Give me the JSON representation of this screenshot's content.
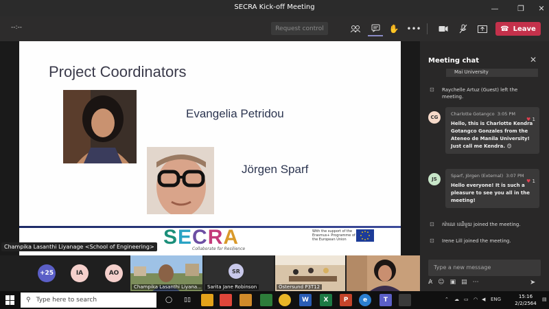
{
  "window": {
    "title": "SECRA Kick-off Meeting"
  },
  "toolbar": {
    "timer": "--:--",
    "request_control": "Request control",
    "leave": "Leave"
  },
  "slide": {
    "title": "Project Coordinators",
    "person1": "Evangelia Petridou",
    "person2": "Jörgen Sparf",
    "logo_letters": [
      "S",
      "E",
      "C",
      "R",
      "A"
    ],
    "tagline": "Collaborate for Resilience",
    "erasmus": "With the support of the Erasmus+ Programme of the European Union"
  },
  "presenter_label": "Champika Lasanthi Liyanage <School of Engineering>",
  "participants": {
    "more": "+25",
    "avatars": [
      "IA",
      "AO"
    ],
    "tiles": {
      "champika": "Champika Lasanthi Liyana...",
      "sarita_initials": "SR",
      "sarita": "Sarita Jane Robinson",
      "ostersund": "Östersund P3T12"
    }
  },
  "chat": {
    "header": "Meeting chat",
    "cut_text": "Mai University",
    "sys1": "Raychelle Artuz (Guest) left the meeting.",
    "msg1": {
      "initials": "CG",
      "author": "Charlotte Gotangco",
      "time": "3:05 PM",
      "text": "Hello, this is Charlotte Kendra Gotangco Gonzales from the Ateneo de Manila University! Just call me Kendra. 😊",
      "reactions": "1"
    },
    "msg2": {
      "initials": "JS",
      "author": "Sparf, Jörgen (External)",
      "time": "3:07 PM",
      "text": "Hello everyone! It is such a pleasure to see you all in the meeting!",
      "reactions": "1"
    },
    "sys2": "ករ៉ា​ណេ ឈើមួយ joined the meeting.",
    "sys3": "Irene Lill joined the meeting.",
    "input_placeholder": "Type a new message"
  },
  "taskbar": {
    "search_placeholder": "Type here to search",
    "lang": "ENG",
    "time": "15:16",
    "date": "2/2/2564"
  },
  "colors": {
    "leave": "#c4314b",
    "accent": "#5b5fc7",
    "heart": "#e04050"
  }
}
